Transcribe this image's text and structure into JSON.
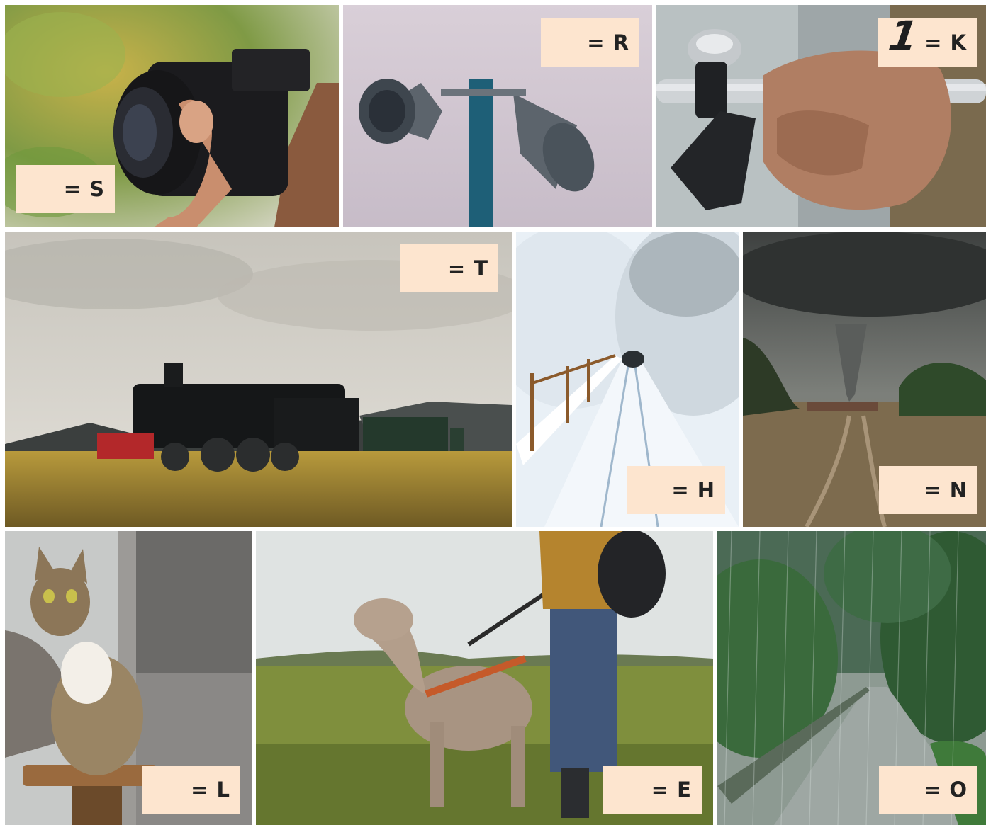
{
  "tiles": [
    {
      "scene": "camera-photo",
      "label": "= S"
    },
    {
      "scene": "siren-photo",
      "label": "= R"
    },
    {
      "scene": "bicycle-bell-photo",
      "number": "1",
      "label": "= K"
    },
    {
      "scene": "steam-train-photo",
      "label": "= T"
    },
    {
      "scene": "snowy-path-photo",
      "label": "= H"
    },
    {
      "scene": "tornado-photo",
      "label": "= N"
    },
    {
      "scene": "cat-photo",
      "label": "= L"
    },
    {
      "scene": "dog-photo",
      "label": "= E"
    },
    {
      "scene": "rain-road-photo",
      "label": "= O"
    }
  ],
  "colors": {
    "tag_background": "#fde5cf",
    "tag_text": "#222222"
  }
}
